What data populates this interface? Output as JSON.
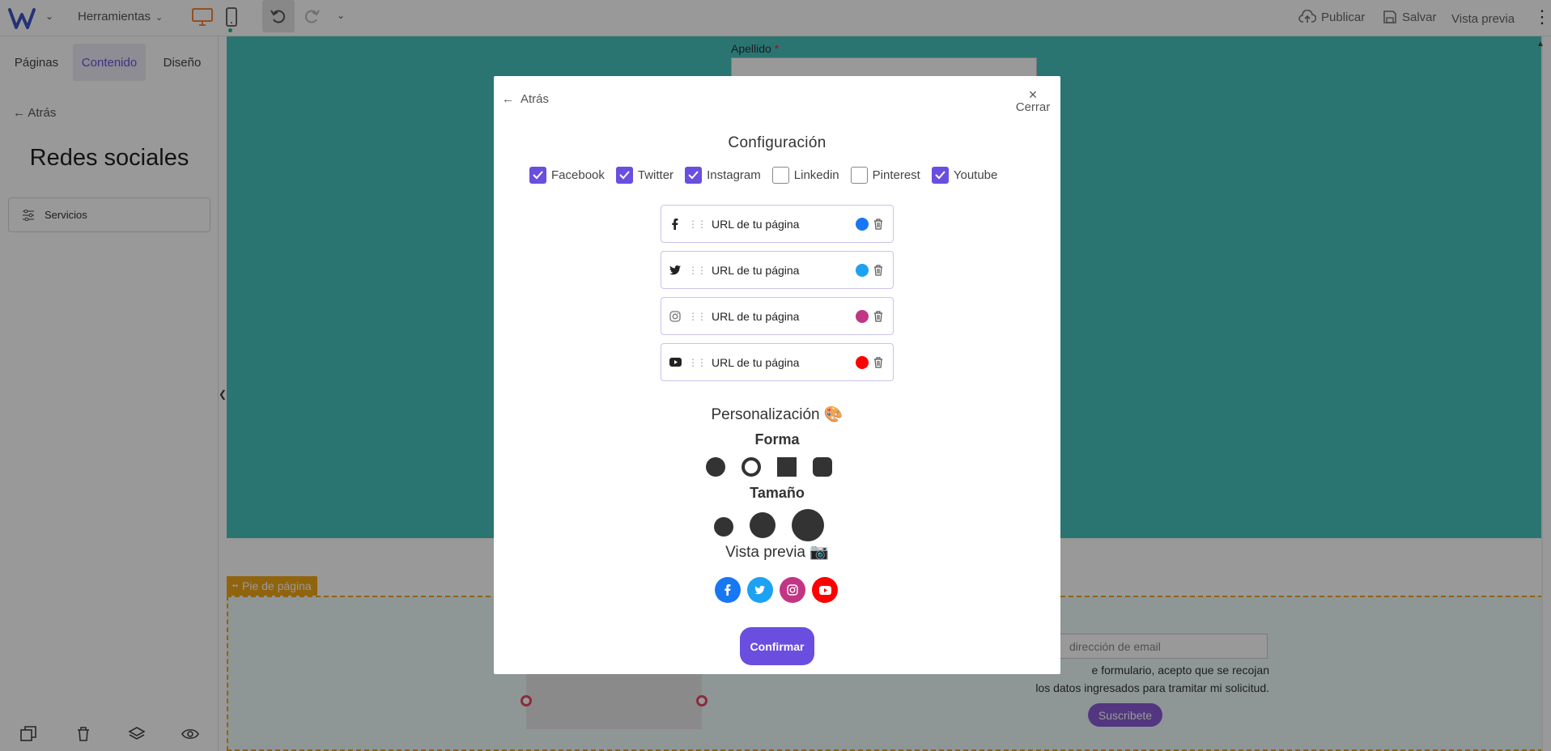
{
  "topbar": {
    "tools_label": "Herramientas",
    "publish_label": "Publicar",
    "save_label": "Salvar",
    "preview_label": "Vista previa"
  },
  "sidebar": {
    "tabs": [
      "Páginas",
      "Contenido",
      "Diseño"
    ],
    "active_tab": "Contenido",
    "back_label": "Atrás",
    "heading": "Redes sociales",
    "service_label": "Servicios"
  },
  "canvas": {
    "field_label": "Apellido",
    "required_mark": "*",
    "footer_section_label": "Pie de página",
    "email_placeholder": "dirección de email",
    "consent_line1": "e formulario, acepto que se recojan",
    "consent_line2": "los datos ingresados para tramitar mi solicitud.",
    "subscribe_label": "Suscribete"
  },
  "modal": {
    "back_label": "Atrás",
    "close_label": "Cerrar",
    "config_title": "Configuración",
    "networks": [
      {
        "name": "Facebook",
        "checked": true
      },
      {
        "name": "Twitter",
        "checked": true
      },
      {
        "name": "Instagram",
        "checked": true
      },
      {
        "name": "Linkedin",
        "checked": false
      },
      {
        "name": "Pinterest",
        "checked": false
      },
      {
        "name": "Youtube",
        "checked": true
      }
    ],
    "url_rows": [
      {
        "network": "facebook",
        "icon": "facebook-icon",
        "url_placeholder": "URL de tu página",
        "color": "#1877f2"
      },
      {
        "network": "twitter",
        "icon": "twitter-icon",
        "url_placeholder": "URL de tu página",
        "color": "#1da1f2"
      },
      {
        "network": "instagram",
        "icon": "instagram-icon",
        "url_placeholder": "URL de tu página",
        "color": "#c13584"
      },
      {
        "network": "youtube",
        "icon": "youtube-icon",
        "url_placeholder": "URL de tu página",
        "color": "#ff0000"
      }
    ],
    "personalization_title": "Personalización 🎨",
    "shape_title": "Forma",
    "size_title": "Tamaño",
    "preview_title": "Vista previa 📷",
    "confirm_label": "Confirmar"
  },
  "colors": {
    "accent": "#6a4ee0",
    "teal": "#46c3be",
    "footer_tag": "#f0a517"
  }
}
